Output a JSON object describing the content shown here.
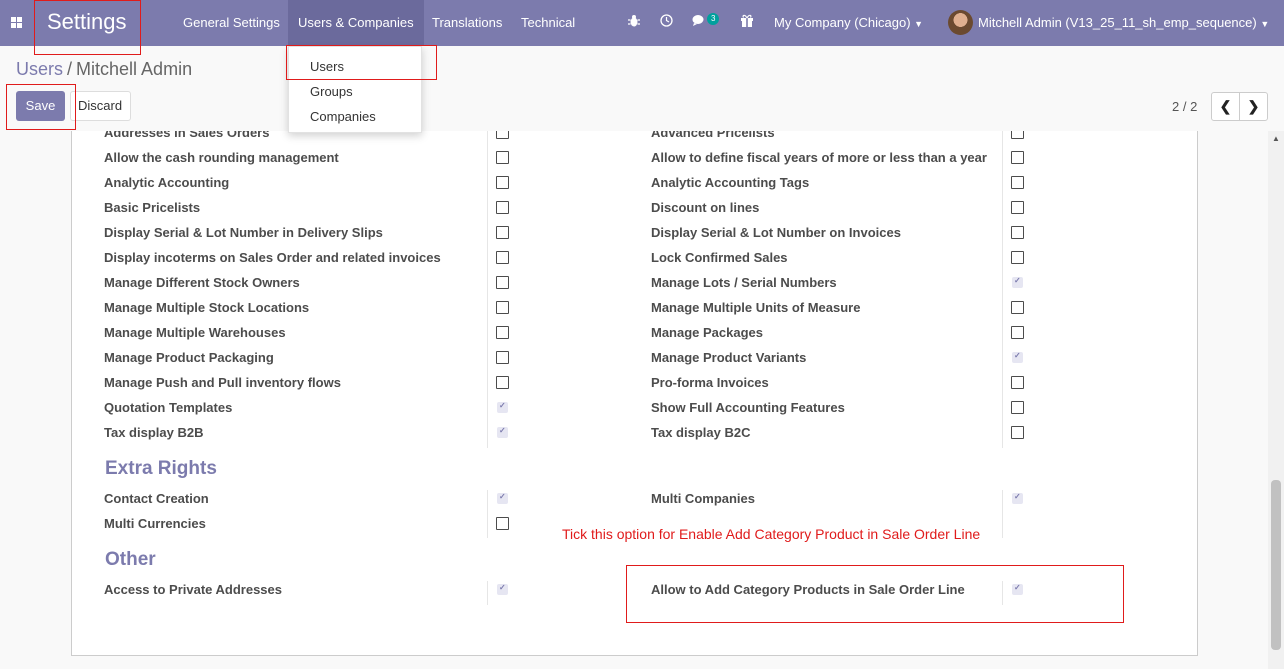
{
  "navbar": {
    "brand": "Settings",
    "menus": [
      "General Settings",
      "Users & Companies",
      "Translations",
      "Technical"
    ],
    "chat_badge": "3",
    "company": "My Company (Chicago)",
    "user": "Mitchell Admin (V13_25_11_sh_emp_sequence)"
  },
  "breadcrumb": {
    "parent": "Users",
    "separator": "/",
    "current": "Mitchell Admin"
  },
  "buttons": {
    "save": "Save",
    "discard": "Discard"
  },
  "pager": {
    "value": "2 / 2",
    "prev_icon": "chevron-left-icon",
    "next_icon": "chevron-right-icon"
  },
  "dropdown": {
    "items": [
      "Users",
      "Groups",
      "Companies"
    ]
  },
  "sections": {
    "extra_rights": "Extra Rights",
    "other": "Other"
  },
  "fields": {
    "left": [
      {
        "label": "Addresses in Sales Orders",
        "checked": false
      },
      {
        "label": "Allow the cash rounding management",
        "checked": false
      },
      {
        "label": "Analytic Accounting",
        "checked": false
      },
      {
        "label": "Basic Pricelists",
        "checked": false
      },
      {
        "label": "Display Serial & Lot Number in Delivery Slips",
        "checked": false
      },
      {
        "label": "Display incoterms on Sales Order and related invoices",
        "checked": false
      },
      {
        "label": "Manage Different Stock Owners",
        "checked": false
      },
      {
        "label": "Manage Multiple Stock Locations",
        "checked": false
      },
      {
        "label": "Manage Multiple Warehouses",
        "checked": false
      },
      {
        "label": "Manage Product Packaging",
        "checked": false
      },
      {
        "label": "Manage Push and Pull inventory flows",
        "checked": false
      },
      {
        "label": "Quotation Templates",
        "checked": true
      },
      {
        "label": "Tax display B2B",
        "checked": true
      }
    ],
    "right": [
      {
        "label": "Advanced Pricelists",
        "checked": false
      },
      {
        "label": "Allow to define fiscal years of more or less than a year",
        "checked": false
      },
      {
        "label": "Analytic Accounting Tags",
        "checked": false
      },
      {
        "label": "Discount on lines",
        "checked": false
      },
      {
        "label": "Display Serial & Lot Number on Invoices",
        "checked": false
      },
      {
        "label": "Lock Confirmed Sales",
        "checked": false
      },
      {
        "label": "Manage Lots / Serial Numbers",
        "checked": true
      },
      {
        "label": "Manage Multiple Units of Measure",
        "checked": false
      },
      {
        "label": "Manage Packages",
        "checked": false
      },
      {
        "label": "Manage Product Variants",
        "checked": true
      },
      {
        "label": "Pro-forma Invoices",
        "checked": false
      },
      {
        "label": "Show Full Accounting Features",
        "checked": false
      },
      {
        "label": "Tax display B2C",
        "checked": false
      }
    ],
    "extra_left": [
      {
        "label": "Contact Creation",
        "checked": true
      },
      {
        "label": "Multi Currencies",
        "checked": false
      }
    ],
    "extra_right": [
      {
        "label": "Multi Companies",
        "checked": true
      }
    ],
    "other_left": [
      {
        "label": "Access to Private Addresses",
        "checked": true
      }
    ],
    "other_right": [
      {
        "label": "Allow to Add Category Products in Sale Order Line",
        "checked": true
      }
    ]
  },
  "annotation": {
    "note": "Tick this option for Enable Add Category Product in Sale Order Line"
  }
}
